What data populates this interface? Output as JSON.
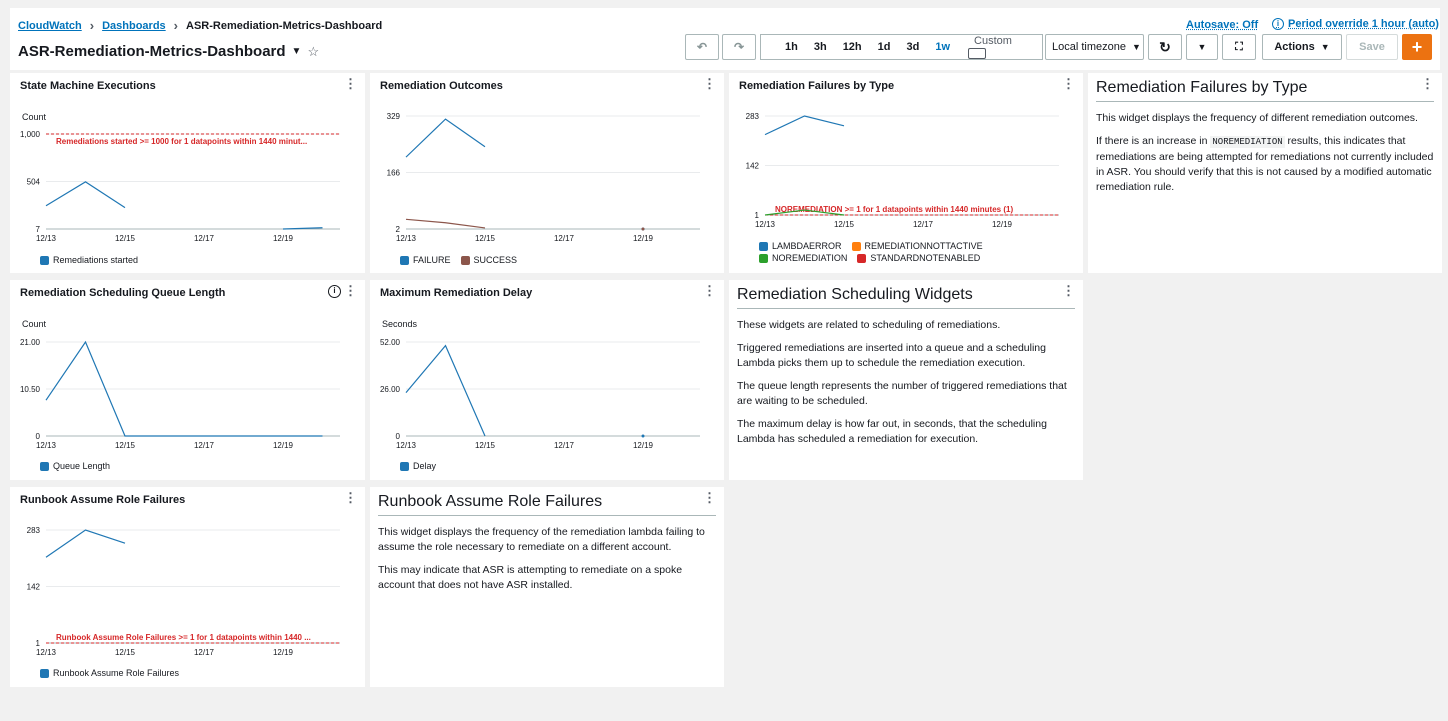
{
  "breadcrumb": {
    "root": "CloudWatch",
    "parent": "Dashboards",
    "current": "ASR-Remediation-Metrics-Dashboard"
  },
  "dashboard": {
    "title": "ASR-Remediation-Metrics-Dashboard"
  },
  "header": {
    "autosave": "Autosave: Off",
    "period_override": "Period override 1 hour (auto)",
    "ranges": [
      "1h",
      "3h",
      "12h",
      "1d",
      "3d",
      "1w"
    ],
    "active_range": "1w",
    "custom": "Custom",
    "timezone": "Local timezone",
    "actions": "Actions",
    "save": "Save"
  },
  "icons": {
    "undo": "undo-icon",
    "redo": "redo-icon",
    "refresh": "refresh-icon",
    "fullscreen": "fullscreen-icon",
    "add": "plus-icon",
    "calendar": "calendar-icon"
  },
  "colors": {
    "blue": "#1f77b4",
    "orange": "#ff7f0e",
    "green": "#2ca02c",
    "red": "#d62728",
    "brown": "#8c564b",
    "link": "#0073bb",
    "accent": "#ec7211"
  },
  "x_ticks": [
    "12/13",
    "12/15",
    "12/17",
    "12/19"
  ],
  "widgets": {
    "sm_exec": {
      "title": "State Machine Executions",
      "unit": "Count",
      "y_ticks": [
        "1,000",
        "504",
        "7"
      ],
      "threshold_label": "Remediations started >= 1000 for 1 datapoints within 1440 minut...",
      "legend": [
        "Remediations started"
      ]
    },
    "outcomes": {
      "title": "Remediation Outcomes",
      "y_ticks": [
        "329",
        "166",
        "2"
      ],
      "legend": [
        "FAILURE",
        "SUCCESS"
      ]
    },
    "failures_type": {
      "title": "Remediation Failures by Type",
      "y_ticks": [
        "283",
        "142",
        "1"
      ],
      "threshold_label": "NOREMEDIATION >= 1 for 1 datapoints within 1440 minutes (1)",
      "legend": [
        "LAMBDAERROR",
        "REMEDIATIONNOTTACTIVE",
        "NOREMEDIATION",
        "STANDARDNOTENABLED"
      ]
    },
    "queue": {
      "title": "Remediation Scheduling Queue Length",
      "unit": "Count",
      "y_ticks": [
        "21.00",
        "10.50",
        "0"
      ],
      "legend": [
        "Queue Length"
      ]
    },
    "delay": {
      "title": "Maximum Remediation Delay",
      "unit": "Seconds",
      "y_ticks": [
        "52.00",
        "26.00",
        "0"
      ],
      "legend": [
        "Delay"
      ]
    },
    "runbook": {
      "title": "Runbook Assume Role Failures",
      "y_ticks": [
        "283",
        "142",
        "1"
      ],
      "threshold_label": "Runbook Assume Role Failures >= 1 for 1 datapoints within 1440 ...",
      "legend": [
        "Runbook Assume Role Failures"
      ]
    },
    "text_failures": {
      "title": "Remediation Failures by Type",
      "p1": "This widget displays the frequency of different remediation outcomes.",
      "p2_pre": "If there is an increase in",
      "p2_code": "NOREMEDIATION",
      "p2_post": "results, this indicates that remediations are being attempted for remediations not currently included in ASR. You should verify that this is not caused by a modified automatic remediation rule."
    },
    "text_scheduling": {
      "title": "Remediation Scheduling Widgets",
      "p1": "These widgets are related to scheduling of remediations.",
      "p2": "Triggered remediations are inserted into a queue and a scheduling Lambda picks them up to schedule the remediation execution.",
      "p3": "The queue length represents the number of triggered remediations that are waiting to be scheduled.",
      "p4": "The maximum delay is how far out, in seconds, that the scheduling Lambda has scheduled a remediation for execution."
    },
    "text_runbook": {
      "title": "Runbook Assume Role Failures",
      "p1": "This widget displays the frequency of the remediation lambda failing to assume the role necessary to remediate on a different account.",
      "p2": "This may indicate that ASR is attempting to remediate on a spoke account that does not have ASR installed."
    }
  },
  "chart_data": [
    {
      "type": "line",
      "title": "State Machine Executions",
      "ylabel": "Count",
      "x": [
        "12/13",
        "12/14",
        "12/15",
        "12/19",
        "12/20"
      ],
      "ylim": [
        7,
        1000
      ],
      "series": [
        {
          "name": "Remediations started",
          "values": [
            250,
            500,
            230,
            7,
            20
          ]
        }
      ],
      "threshold": 1000
    },
    {
      "type": "line",
      "title": "Remediation Outcomes",
      "x": [
        "12/13",
        "12/14",
        "12/15",
        "12/19"
      ],
      "ylim": [
        2,
        329
      ],
      "series": [
        {
          "name": "FAILURE",
          "values": [
            210,
            320,
            240,
            2
          ]
        },
        {
          "name": "SUCCESS",
          "values": [
            30,
            20,
            5,
            2
          ]
        }
      ]
    },
    {
      "type": "line",
      "title": "Remediation Failures by Type",
      "x": [
        "12/13",
        "12/14",
        "12/15"
      ],
      "ylim": [
        1,
        283
      ],
      "series": [
        {
          "name": "LAMBDAERROR",
          "values": [
            230,
            283,
            255
          ]
        },
        {
          "name": "NOREMEDIATION",
          "values": [
            1,
            15,
            1
          ]
        }
      ],
      "threshold": 1
    },
    {
      "type": "line",
      "title": "Remediation Scheduling Queue Length",
      "ylabel": "Count",
      "x": [
        "12/13",
        "12/14",
        "12/15",
        "12/17",
        "12/19",
        "12/20"
      ],
      "ylim": [
        0,
        21
      ],
      "series": [
        {
          "name": "Queue Length",
          "values": [
            8,
            21,
            0,
            0,
            0,
            0
          ]
        }
      ]
    },
    {
      "type": "line",
      "title": "Maximum Remediation Delay",
      "ylabel": "Seconds",
      "x": [
        "12/13",
        "12/14",
        "12/15",
        "12/19"
      ],
      "ylim": [
        0,
        52
      ],
      "series": [
        {
          "name": "Delay",
          "values": [
            24,
            50,
            0,
            0
          ]
        }
      ]
    },
    {
      "type": "line",
      "title": "Runbook Assume Role Failures",
      "x": [
        "12/13",
        "12/14",
        "12/15"
      ],
      "ylim": [
        1,
        283
      ],
      "series": [
        {
          "name": "Runbook Assume Role Failures",
          "values": [
            215,
            283,
            250
          ]
        }
      ],
      "threshold": 1
    }
  ]
}
